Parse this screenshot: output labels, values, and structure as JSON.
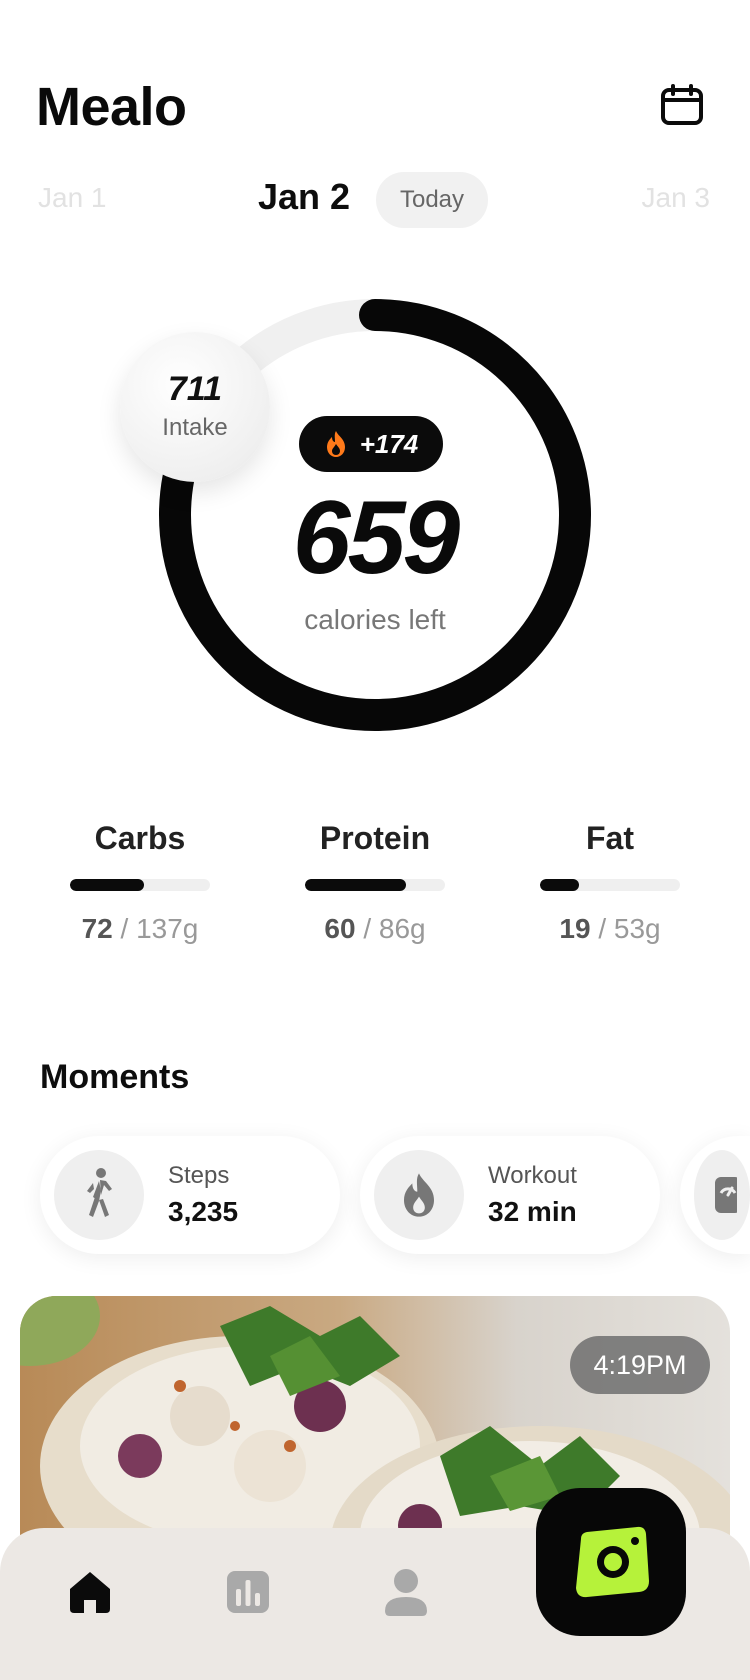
{
  "app": {
    "title": "Mealo"
  },
  "dates": {
    "previous": "Jan 1",
    "current": "Jan 2",
    "next": "Jan 3",
    "today_label": "Today"
  },
  "summary": {
    "intake_value": "711",
    "intake_label": "Intake",
    "burned": "+174",
    "calories_left": "659",
    "calories_left_label": "calories left",
    "ring_progress": 0.78
  },
  "macros": [
    {
      "name": "Carbs",
      "consumed": "72",
      "goal": "/ 137g",
      "progress": 0.53
    },
    {
      "name": "Protein",
      "consumed": "60",
      "goal": "/ 86g",
      "progress": 0.72
    },
    {
      "name": "Fat",
      "consumed": "19",
      "goal": "/ 53g",
      "progress": 0.28
    }
  ],
  "moments": {
    "title": "Moments",
    "items": [
      {
        "label": "Steps",
        "value": "3,235",
        "icon": "walking-person-icon"
      },
      {
        "label": "Workout",
        "value": "32 min",
        "icon": "flame-icon"
      },
      {
        "label": "",
        "value": "",
        "icon": "gauge-icon"
      }
    ]
  },
  "meal": {
    "time": "4:19PM"
  },
  "tabs": [
    {
      "name": "home",
      "icon": "home-icon",
      "active": true
    },
    {
      "name": "stats",
      "icon": "bar-chart-icon",
      "active": false
    },
    {
      "name": "profile",
      "icon": "person-icon",
      "active": false
    }
  ],
  "colors": {
    "accent": "#b6f23a",
    "flame": "#ff7a1a",
    "dark": "#0b0b0b",
    "tab_bar": "#ece8e4"
  }
}
